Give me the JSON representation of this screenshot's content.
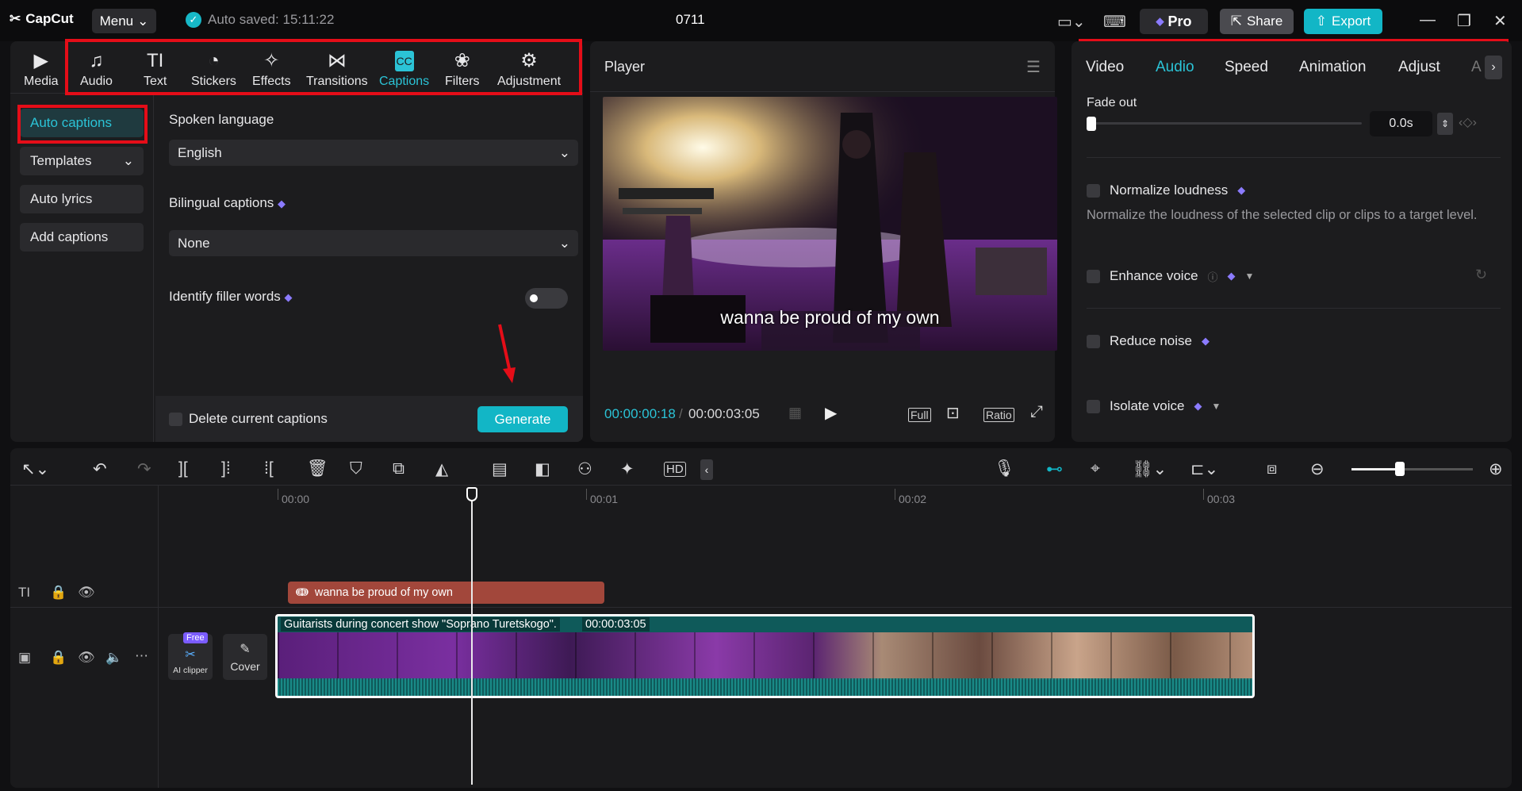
{
  "app": {
    "name": "CapCut",
    "menu_label": "Menu",
    "autosave_text": "Auto saved: 15:11:22",
    "project_title": "0711"
  },
  "header": {
    "pro_label": "Pro",
    "share_label": "Share",
    "export_label": "Export"
  },
  "toolbar": {
    "items": [
      {
        "label": "Media",
        "icon": "media-icon"
      },
      {
        "label": "Audio",
        "icon": "audio-icon"
      },
      {
        "label": "Text",
        "icon": "text-icon"
      },
      {
        "label": "Stickers",
        "icon": "stickers-icon"
      },
      {
        "label": "Effects",
        "icon": "effects-icon"
      },
      {
        "label": "Transitions",
        "icon": "transitions-icon"
      },
      {
        "label": "Captions",
        "icon": "captions-icon",
        "active": true
      },
      {
        "label": "Filters",
        "icon": "filters-icon"
      },
      {
        "label": "Adjustment",
        "icon": "adjustment-icon"
      }
    ]
  },
  "captions_panel": {
    "side": [
      "Auto captions",
      "Templates",
      "Auto lyrics",
      "Add captions"
    ],
    "spoken_language_label": "Spoken language",
    "spoken_language_value": "English",
    "bilingual_label": "Bilingual captions",
    "bilingual_value": "None",
    "filler_label": "Identify filler words",
    "delete_label": "Delete current captions",
    "generate_label": "Generate"
  },
  "player": {
    "title": "Player",
    "caption_overlay": "wanna be proud of my own",
    "current_time": "00:00:00:18",
    "total_time": "00:00:03:05",
    "full_label": "Full",
    "ratio_label": "Ratio"
  },
  "inspector": {
    "tabs": [
      "Video",
      "Audio",
      "Speed",
      "Animation",
      "Adjust",
      "A"
    ],
    "fade_out_label": "Fade out",
    "fade_out_value": "0.0s",
    "normalize_label": "Normalize loudness",
    "normalize_desc": "Normalize the loudness of the selected clip or clips to a target level.",
    "enhance_label": "Enhance voice",
    "reduce_label": "Reduce noise",
    "isolate_label": "Isolate voice"
  },
  "timeline": {
    "ruler": [
      "00:00",
      "00:01",
      "00:02",
      "00:03"
    ],
    "text_clip": "wanna be proud of my own",
    "video_clip_title": "Guitarists during concert show \"Soprano Turetskogo\".",
    "video_clip_duration": "00:00:03:05",
    "free_badge": "Free",
    "ai_clipper_label": "AI clipper",
    "cover_label": "Cover"
  },
  "colors": {
    "accent": "#12b6c6",
    "highlight_box": "#e50d18",
    "text_clip": "#a2473b"
  }
}
